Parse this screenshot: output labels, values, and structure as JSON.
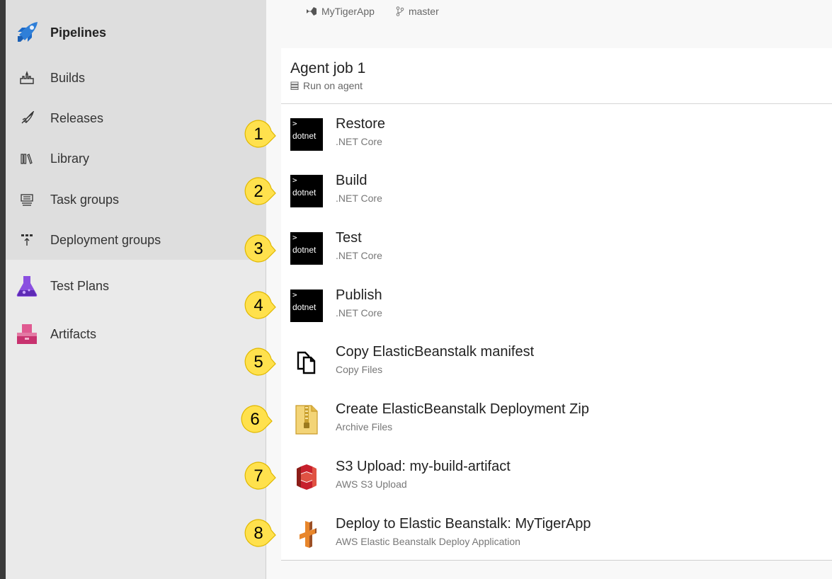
{
  "sidebar": {
    "primary": {
      "label": "Pipelines",
      "icon": "pipelines-icon",
      "color": "#1b6ac9"
    },
    "subnav": [
      {
        "label": "Builds",
        "icon": "builds-icon"
      },
      {
        "label": "Releases",
        "icon": "releases-rocket-icon"
      },
      {
        "label": "Library",
        "icon": "library-icon"
      },
      {
        "label": "Task groups",
        "icon": "task-groups-icon"
      },
      {
        "label": "Deployment groups",
        "icon": "deployment-groups-icon"
      }
    ],
    "hubs": [
      {
        "label": "Test Plans",
        "icon": "test-plans-flask-icon",
        "color": "#773adc"
      },
      {
        "label": "Artifacts",
        "icon": "artifacts-package-icon",
        "color": "#cb2e6d"
      }
    ]
  },
  "topbar": {
    "repo": "MyTigerApp",
    "branch": "master"
  },
  "job": {
    "title": "Agent job 1",
    "subtitle": "Run on agent"
  },
  "tasks": [
    {
      "number": "1",
      "name": "Restore",
      "type": ".NET Core",
      "icon": "dotnet-icon"
    },
    {
      "number": "2",
      "name": "Build",
      "type": ".NET Core",
      "icon": "dotnet-icon"
    },
    {
      "number": "3",
      "name": "Test",
      "type": ".NET Core",
      "icon": "dotnet-icon"
    },
    {
      "number": "4",
      "name": "Publish",
      "type": ".NET Core",
      "icon": "dotnet-icon"
    },
    {
      "number": "5",
      "name": "Copy ElasticBeanstalk manifest",
      "type": "Copy Files",
      "icon": "copy-files-icon"
    },
    {
      "number": "6",
      "name": "Create ElasticBeanstalk Deployment Zip",
      "type": "Archive Files",
      "icon": "archive-zip-icon"
    },
    {
      "number": "7",
      "name": "S3 Upload: my-build-artifact",
      "type": "AWS S3 Upload",
      "icon": "aws-s3-icon"
    },
    {
      "number": "8",
      "name": "Deploy to Elastic Beanstalk: MyTigerApp",
      "type": "AWS Elastic Beanstalk Deploy Application",
      "icon": "aws-elastic-beanstalk-icon"
    }
  ],
  "dotnet_label": "dotnet",
  "dotnet_prompt": ">",
  "colors": {
    "callout": "#ffe14d",
    "callout_border": "#e0b800",
    "aws_s3": "#c7202c",
    "aws_eb": "#e8862b"
  }
}
